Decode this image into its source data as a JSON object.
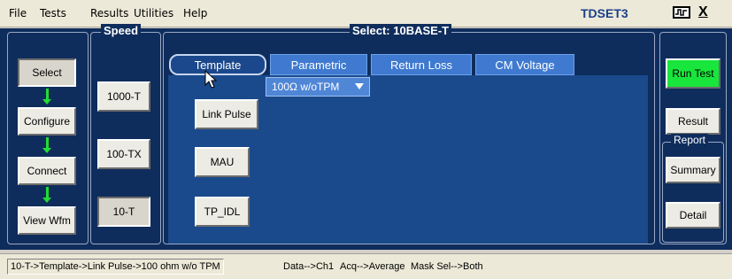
{
  "menu": {
    "items": [
      "File",
      "Tests",
      "Results",
      "Utilities",
      "Help"
    ]
  },
  "app": {
    "title": "TDSET3",
    "close_label": "X"
  },
  "nav": {
    "buttons": [
      "Select",
      "Configure",
      "Connect",
      "View Wfm"
    ]
  },
  "speed": {
    "title": "Speed",
    "buttons": [
      "1000-T",
      "100-TX",
      "10-T"
    ]
  },
  "select": {
    "title": "Select: 10BASE-T",
    "tabs": [
      "Template",
      "Parametric",
      "Return Loss",
      "CM Voltage"
    ],
    "active_tab": "Template",
    "buttons": [
      "Link Pulse",
      "MAU",
      "TP_IDL"
    ],
    "dropdown_value": "100Ω w/oTPM"
  },
  "right": {
    "run_label": "Run Test",
    "result_label": "Result",
    "report_title": "Report",
    "summary_label": "Summary",
    "detail_label": "Detail"
  },
  "status": {
    "path": "10-T->Template->Link Pulse->100 ohm w/o TPM",
    "data": "Data-->Ch1",
    "acq": "Acq-->Average",
    "mask": "Mask Sel-->Both"
  },
  "colors": {
    "background": "#0f2d5c",
    "tab": "#3f7ad0",
    "run_button": "#19e63c",
    "arrow": "#22dd33",
    "title": "#1b3f8a"
  }
}
